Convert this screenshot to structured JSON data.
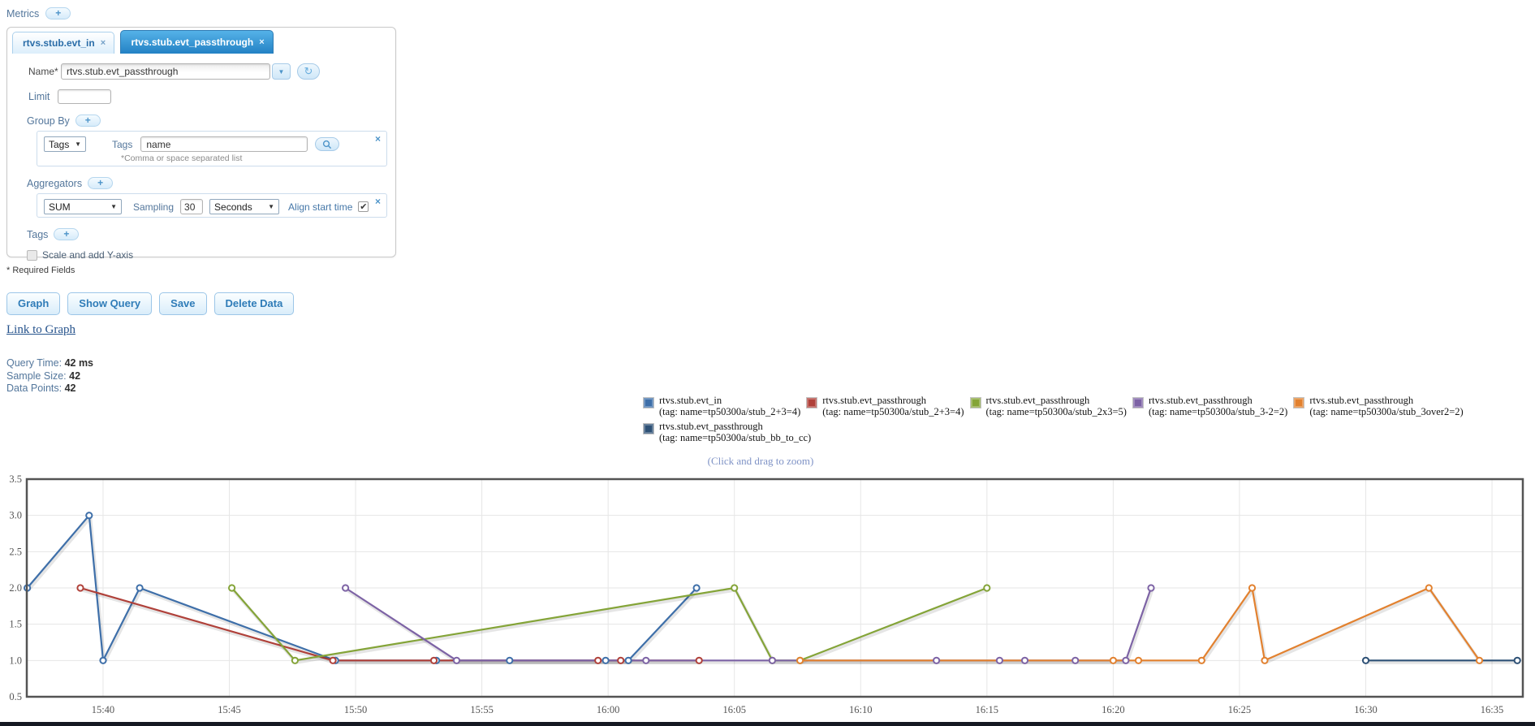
{
  "ui": {
    "plus": "+",
    "close": "×",
    "dropdown_arrow": "▼",
    "refresh": "↻",
    "check": "✔"
  },
  "header": {
    "metrics_label": "Metrics"
  },
  "metric_panel": {
    "tabs": [
      {
        "label": "rtvs.stub.evt_in"
      },
      {
        "label": "rtvs.stub.evt_passthrough"
      }
    ],
    "name": {
      "label": "Name*",
      "value": "rtvs.stub.evt_passthrough"
    },
    "limit": {
      "label": "Limit",
      "value": ""
    },
    "group_by": {
      "label": "Group By",
      "type_selected": "Tags",
      "tags_label": "Tags",
      "tags_value": "name",
      "hint": "*Comma or space separated list"
    },
    "aggregators": {
      "label": "Aggregators",
      "aggregator_selected": "SUM",
      "sampling_label": "Sampling",
      "sampling_value": "30",
      "unit_selected": "Seconds",
      "align_label": "Align start time"
    },
    "tags_section": {
      "label": "Tags"
    },
    "scale_checkbox": {
      "label": "Scale and add Y-axis"
    },
    "required_note": "* Required Fields"
  },
  "actions": [
    {
      "label": "Graph"
    },
    {
      "label": "Show Query"
    },
    {
      "label": "Save"
    },
    {
      "label": "Delete Data"
    }
  ],
  "link_to_graph": "Link to Graph",
  "stats": [
    {
      "label": "Query Time:",
      "value": "42 ms"
    },
    {
      "label": "Sample Size:",
      "value": "42"
    },
    {
      "label": "Data Points:",
      "value": "42"
    }
  ],
  "legend_caption": "(Click and drag to zoom)",
  "chart_data": {
    "type": "line",
    "x_domain": [
      36.98,
      96.22
    ],
    "y_domain": [
      0.5,
      3.5
    ],
    "x_ticks": [
      {
        "v": 40,
        "label": "15:40"
      },
      {
        "v": 45,
        "label": "15:45"
      },
      {
        "v": 50,
        "label": "15:50"
      },
      {
        "v": 55,
        "label": "15:55"
      },
      {
        "v": 60,
        "label": "16:00"
      },
      {
        "v": 65,
        "label": "16:05"
      },
      {
        "v": 70,
        "label": "16:10"
      },
      {
        "v": 75,
        "label": "16:15"
      },
      {
        "v": 80,
        "label": "16:20"
      },
      {
        "v": 85,
        "label": "16:25"
      },
      {
        "v": 90,
        "label": "16:30"
      },
      {
        "v": 95,
        "label": "16:35"
      }
    ],
    "y_ticks": [
      {
        "v": 0.5,
        "label": "0.5"
      },
      {
        "v": 1.0,
        "label": "1.0"
      },
      {
        "v": 1.5,
        "label": "1.5"
      },
      {
        "v": 2.0,
        "label": "2.0"
      },
      {
        "v": 2.5,
        "label": "2.5"
      },
      {
        "v": 3.0,
        "label": "3.0"
      },
      {
        "v": 3.5,
        "label": "3.5"
      }
    ],
    "x_unit": "minutes after 15:00",
    "grid": true,
    "legend_position": "top",
    "series": [
      {
        "name": "rtvs.stub.evt_in",
        "tag_label": "(tag: name=tp50300a/stub_2+3=4)",
        "color": "#3e6fa9",
        "points": [
          [
            37.0,
            2
          ],
          [
            39.45,
            3
          ],
          [
            40.0,
            1
          ],
          [
            41.45,
            2
          ],
          [
            49.2,
            1
          ],
          [
            53.2,
            1
          ],
          [
            56.1,
            1
          ],
          [
            59.9,
            1
          ],
          [
            60.8,
            1
          ],
          [
            63.5,
            2
          ]
        ]
      },
      {
        "name": "rtvs.stub.evt_passthrough",
        "tag_label": "(tag: name=tp50300a/stub_2+3=4)",
        "color": "#b0413a",
        "points": [
          [
            39.1,
            2
          ],
          [
            49.1,
            1
          ],
          [
            53.1,
            1
          ],
          [
            59.6,
            1
          ],
          [
            60.5,
            1
          ],
          [
            63.6,
            1
          ]
        ]
      },
      {
        "name": "rtvs.stub.evt_passthrough",
        "tag_label": "(tag: name=tp50300a/stub_2x3=5)",
        "color": "#84a438",
        "points": [
          [
            45.1,
            2
          ],
          [
            47.6,
            1
          ],
          [
            65.0,
            2
          ],
          [
            66.5,
            1
          ],
          [
            67.6,
            1
          ],
          [
            75.0,
            2
          ]
        ]
      },
      {
        "name": "rtvs.stub.evt_passthrough",
        "tag_label": "(tag: name=tp50300a/stub_3-2=2)",
        "color": "#7d63a5",
        "points": [
          [
            49.6,
            2
          ],
          [
            54.0,
            1
          ],
          [
            61.5,
            1
          ],
          [
            66.5,
            1
          ],
          [
            73.0,
            1
          ],
          [
            75.5,
            1
          ],
          [
            76.5,
            1
          ],
          [
            78.5,
            1
          ],
          [
            80.5,
            1
          ],
          [
            81.5,
            2
          ]
        ]
      },
      {
        "name": "rtvs.stub.evt_passthrough",
        "tag_label": "(tag: name=tp50300a/stub_3over2=2)",
        "color": "#e2812f",
        "points": [
          [
            67.6,
            1
          ],
          [
            80.0,
            1
          ],
          [
            81.0,
            1
          ],
          [
            83.5,
            1
          ],
          [
            85.5,
            2
          ],
          [
            86.0,
            1
          ],
          [
            92.5,
            2
          ],
          [
            94.5,
            1
          ]
        ]
      },
      {
        "name": "rtvs.stub.evt_passthrough",
        "tag_label": "(tag: name=tp50300a/stub_bb_to_cc)",
        "color": "#2e5176",
        "points": [
          [
            90.0,
            1
          ],
          [
            96.0,
            1
          ]
        ]
      }
    ]
  }
}
